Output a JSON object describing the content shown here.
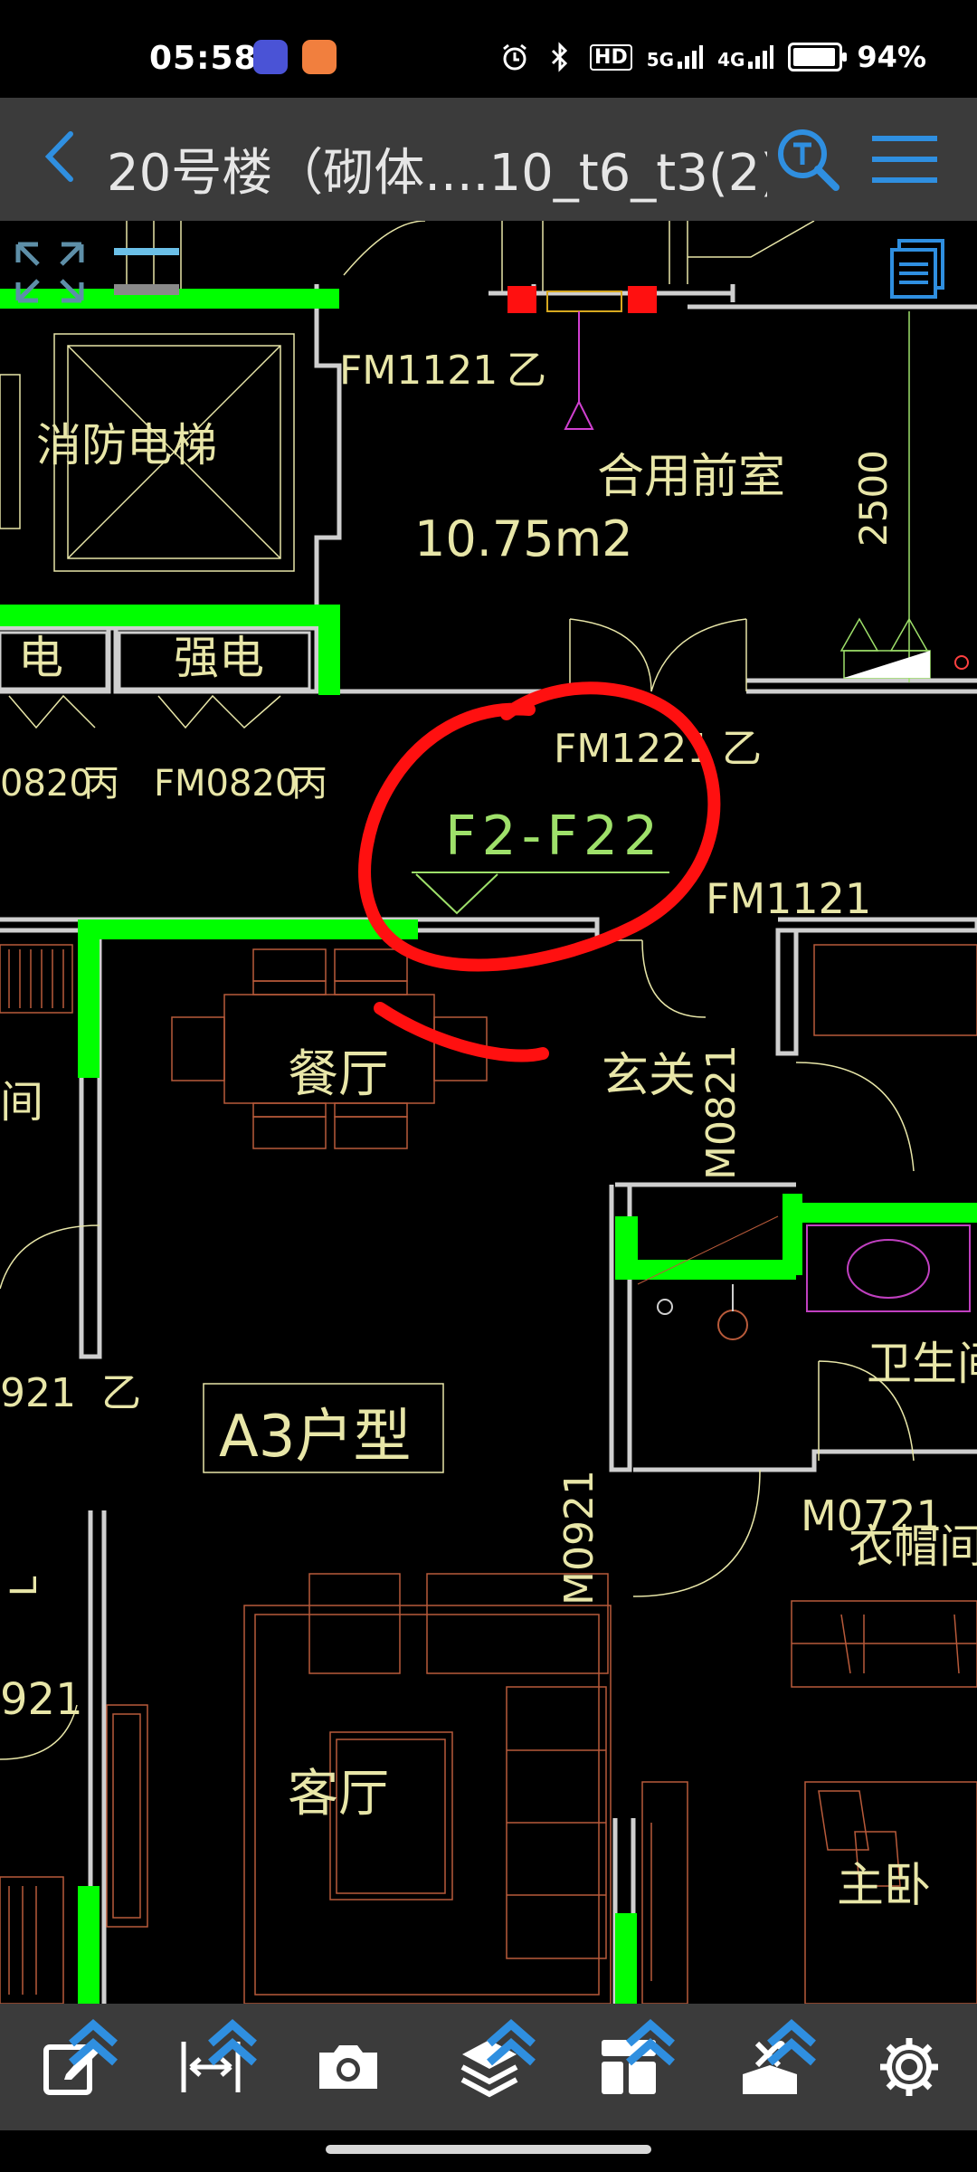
{
  "status_bar": {
    "time": "05:58",
    "hd_label": "HD",
    "net1": "5G",
    "net2": "4G",
    "battery": "94%",
    "battery_level": 0.94
  },
  "title_bar": {
    "title": "20号楼（砌体....10_t6_t3(2)",
    "search_icon": "text-search-icon",
    "menu_icon": "hamburger-menu-icon"
  },
  "drawing": {
    "rooms": {
      "fire_elevator": "消防电梯",
      "lobby": "合用前室",
      "lobby_area": "10.75m2",
      "elec_left": "电",
      "elec_strong": "强电",
      "dining": "餐厅",
      "foyer": "玄关",
      "unit_type": "A3户型",
      "bathroom": "卫生间",
      "cloakroom": "衣帽间",
      "living": "客厅",
      "master": "主卧",
      "left_room": "间",
      "left_room2": "L"
    },
    "door_labels": {
      "fm1121_top": "FM1121",
      "fm1121_top_grade": "乙",
      "fm0820_a": "0820",
      "fm0820_a_grade": "丙",
      "fm0820_b": "FM0820",
      "fm0820_b_grade": "丙",
      "fm1221": "FM1221",
      "fm1221_grade": "乙",
      "fm1121_right": "FM1121",
      "m0821": "M0821",
      "m0921": "M0921",
      "m0721": "M0721",
      "left_921": "921",
      "left_921_grade": "乙",
      "left_921b": "921"
    },
    "dimension": "2500",
    "floor_range": "F2-F22"
  },
  "bottom_toolbar": {
    "items": [
      {
        "name": "edit-icon",
        "has_caret": true
      },
      {
        "name": "measure-icon",
        "has_caret": true
      },
      {
        "name": "camera-icon",
        "has_caret": false
      },
      {
        "name": "layers-icon",
        "has_caret": true
      },
      {
        "name": "layout-icon",
        "has_caret": true
      },
      {
        "name": "tools-icon",
        "has_caret": true
      },
      {
        "name": "settings-icon",
        "has_caret": false
      }
    ]
  },
  "colors": {
    "accent_blue": "#2f8fe0",
    "wall_green": "#00ff00",
    "wall_gray": "#cfcfcf",
    "annotation_red": "#ff1010",
    "cad_yellow": "#e8e6a8",
    "cad_green": "#9ee06a",
    "toolbar_bg": "#3b3b3b"
  }
}
